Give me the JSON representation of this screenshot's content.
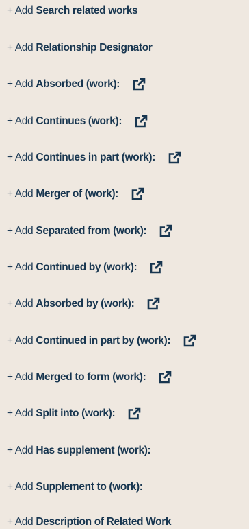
{
  "add_prefix": "+ Add",
  "items": [
    {
      "label": "Search related works",
      "external": false
    },
    {
      "label": "Relationship Designator",
      "external": false
    },
    {
      "label": "Absorbed (work):",
      "external": true
    },
    {
      "label": "Continues (work):",
      "external": true
    },
    {
      "label": "Continues in part (work):",
      "external": true
    },
    {
      "label": "Merger of (work):",
      "external": true
    },
    {
      "label": "Separated from (work):",
      "external": true
    },
    {
      "label": "Continued by (work):",
      "external": true
    },
    {
      "label": "Absorbed by (work):",
      "external": true
    },
    {
      "label": "Continued in part by (work):",
      "external": true
    },
    {
      "label": "Merged to form (work):",
      "external": true
    },
    {
      "label": "Split into (work):",
      "external": true
    },
    {
      "label": "Has supplement (work):",
      "external": false
    },
    {
      "label": "Supplement to (work):",
      "external": false
    },
    {
      "label": "Description of Related Work",
      "external": false
    }
  ],
  "icons": {
    "external_link": "external-link-icon"
  },
  "colors": {
    "background": "#efe8e0",
    "text": "#183650",
    "icon": "#183650"
  }
}
